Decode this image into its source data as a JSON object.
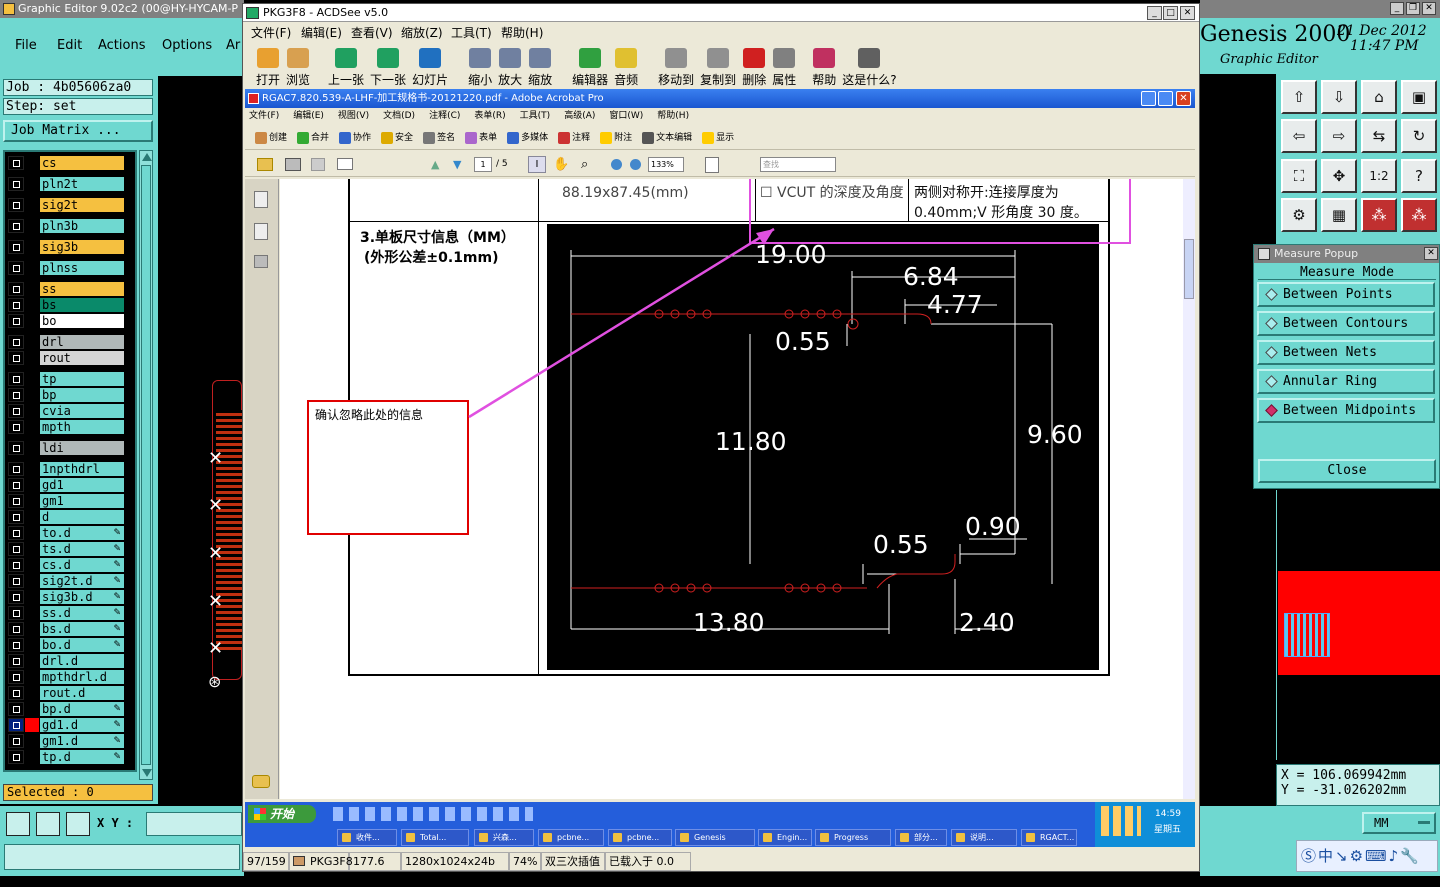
{
  "genesis": {
    "title": "Graphic Editor 9.02c2 (00@HY-HYCAM-P",
    "menu": [
      "File",
      "Edit",
      "Actions",
      "Options",
      "Ar"
    ],
    "job_label": "Job : 4b05606za0",
    "step_label": "Step: set",
    "job_matrix": "Job Matrix ...",
    "layers": [
      {
        "name": "cs",
        "color": "#f5c040"
      },
      {
        "name": "pln2t",
        "color": "#6fd8d0"
      },
      {
        "name": "sig2t",
        "color": "#f5c040"
      },
      {
        "name": "pln3b",
        "color": "#6fd8d0"
      },
      {
        "name": "sig3b",
        "color": "#f5c040"
      },
      {
        "name": "plnss",
        "color": "#6fd8d0"
      },
      {
        "name": "ss",
        "color": "#f5c040"
      },
      {
        "name": "bs",
        "color": "#0a8a6a"
      },
      {
        "name": "bo",
        "color": "#ffffff"
      },
      {
        "name": "drl",
        "color": "#b0b8b8"
      },
      {
        "name": "rout",
        "color": "#d4d4d4"
      },
      {
        "name": "tp",
        "color": "#6fd8d0"
      },
      {
        "name": "bp",
        "color": "#6fd8d0"
      },
      {
        "name": "cvia",
        "color": "#6fd8d0"
      },
      {
        "name": "mpth",
        "color": "#6fd8d0"
      },
      {
        "name": "ldi",
        "color": "#b0b8b8"
      },
      {
        "name": "1npthdrl",
        "color": "#6fd8d0"
      },
      {
        "name": "gd1",
        "color": "#6fd8d0"
      },
      {
        "name": "gm1",
        "color": "#6fd8d0"
      },
      {
        "name": "d",
        "color": "#6fd8d0"
      },
      {
        "name": "to.d",
        "color": "#6fd8d0"
      },
      {
        "name": "ts.d",
        "color": "#6fd8d0"
      },
      {
        "name": "cs.d",
        "color": "#6fd8d0"
      },
      {
        "name": "sig2t.d",
        "color": "#6fd8d0"
      },
      {
        "name": "sig3b.d",
        "color": "#6fd8d0"
      },
      {
        "name": "ss.d",
        "color": "#6fd8d0"
      },
      {
        "name": "bs.d",
        "color": "#6fd8d0"
      },
      {
        "name": "bo.d",
        "color": "#6fd8d0"
      },
      {
        "name": "drl.d",
        "color": "#6fd8d0"
      },
      {
        "name": "mpthdrl.d",
        "color": "#6fd8d0"
      },
      {
        "name": "rout.d",
        "color": "#6fd8d0"
      },
      {
        "name": "bp.d",
        "color": "#6fd8d0"
      },
      {
        "name": "gd1.d",
        "color": "#6fd8d0"
      },
      {
        "name": "gm1.d",
        "color": "#6fd8d0"
      },
      {
        "name": "tp.d",
        "color": "#6fd8d0"
      }
    ],
    "selected": "Selected : 0",
    "xy_label": "X Y :",
    "brand": "Genesis 2000",
    "date": "21 Dec 2012",
    "time": "11:47 PM",
    "subtitle": "Graphic Editor",
    "coord_x": "X = 106.069942mm",
    "coord_y": "Y = -31.026202mm",
    "units": "MM"
  },
  "measure": {
    "title": "Measure Popup",
    "mode": "Measure Mode",
    "options": [
      "Between Points",
      "Between Contours",
      "Between Nets",
      "Annular Ring",
      "Between Midpoints"
    ],
    "selected_index": 4,
    "close": "Close"
  },
  "acdsee": {
    "title": "PKG3F8 - ACDSee v5.0",
    "menu": [
      "文件(F)",
      "编辑(E)",
      "查看(V)",
      "缩放(Z)",
      "工具(T)",
      "帮助(H)"
    ],
    "toolbar": [
      "打开",
      "浏览",
      "上一张",
      "下一张",
      "幻灯片",
      "缩小",
      "放大",
      "缩放",
      "编辑器",
      "音频",
      "移动到",
      "复制到",
      "删除",
      "属性",
      "帮助",
      "这是什么?"
    ],
    "status": [
      "97/159",
      "PKG3F8",
      "177.6 KB",
      "1280x1024x24b jpeg",
      "74%",
      "双三次插值",
      "已载入于 0.0 秒"
    ]
  },
  "acrobat": {
    "title": "RGAC7.820.539-A-LHF-加工规格书-20121220.pdf - Adobe Acrobat Pro",
    "menu": [
      "文件(F)",
      "编辑(E)",
      "视图(V)",
      "文档(D)",
      "注释(C)",
      "表单(R)",
      "工具(T)",
      "高级(A)",
      "窗口(W)",
      "帮助(H)"
    ],
    "toolbar": [
      "创建",
      "合并",
      "协作",
      "安全",
      "签名",
      "表单",
      "多媒体",
      "注释",
      "附注",
      "文本编辑",
      "显示"
    ],
    "page_current": "1",
    "page_total": "/ 5",
    "zoom": "133%",
    "find_placeholder": "查找"
  },
  "document": {
    "size_text": "88.19x87.45(mm)",
    "vcut_label": "☐ VCUT 的深度及角度",
    "vcut_value": "两侧对称开:连接厚度为 0.40mm;V 形角度 30 度。",
    "section_title": "3.单板尺寸信息（MM）",
    "section_note": "(外形公差±0.1mm)",
    "annotation": "确认忽略此处的信息",
    "dims": [
      "19.00",
      "6.84",
      "4.77",
      "0.55",
      "11.80",
      "9.60",
      "0.90",
      "0.55",
      "13.80",
      "2.40"
    ]
  },
  "taskbar": {
    "start": "开始",
    "items": [
      "收件...",
      "Total...",
      "兴森...",
      "pcbne...",
      "pcbne...",
      "Genesis",
      "Engin...",
      "Progress",
      "部分...",
      "说明...",
      "RGACT..."
    ],
    "clock": "14:59",
    "weekday": "星期五"
  },
  "colors": {
    "genesis_panel": "#6fd8d0",
    "genesis_field": "#c8f0ec",
    "selected_bg": "#f5c040",
    "xp_blue": "#245edb",
    "annotation_red": "#e00000",
    "highlight_magenta": "#e050e0"
  }
}
